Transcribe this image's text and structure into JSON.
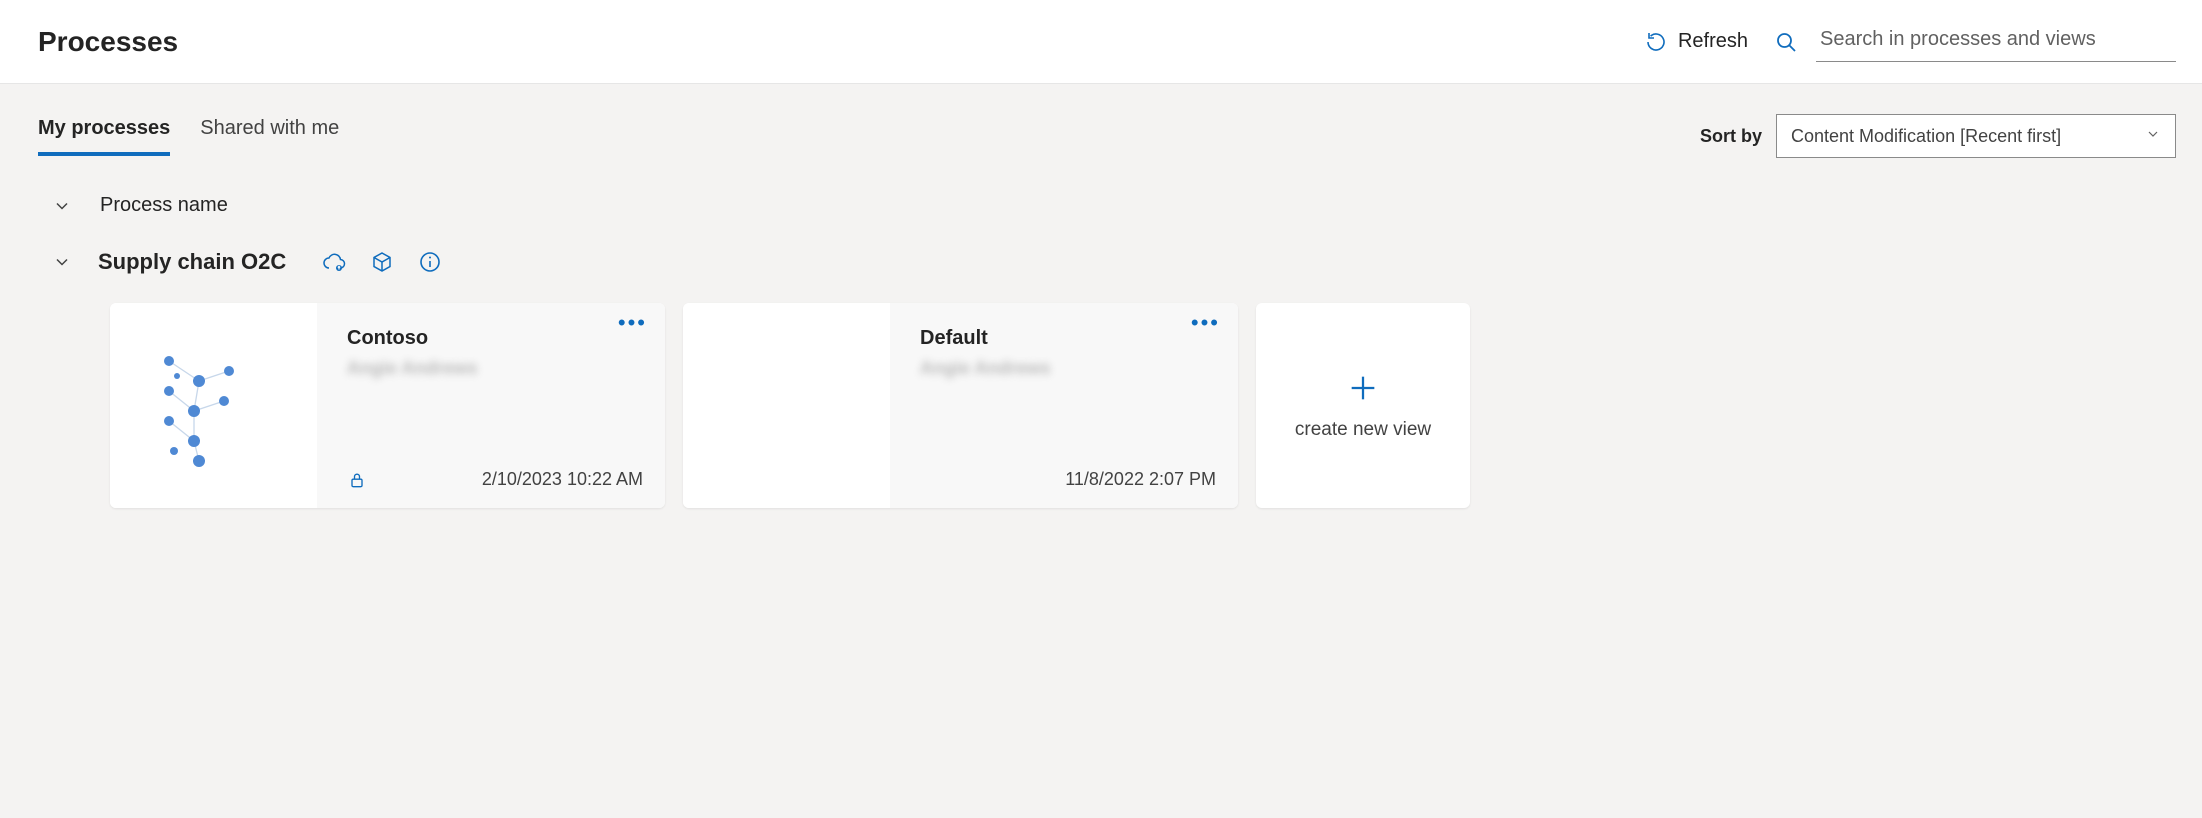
{
  "header": {
    "title": "Processes",
    "refresh_label": "Refresh",
    "search_placeholder": "Search in processes and views"
  },
  "tabs": {
    "my_processes": "My processes",
    "shared_with_me": "Shared with me",
    "active": "my_processes"
  },
  "sort": {
    "label": "Sort by",
    "selected": "Content Modification [Recent first]"
  },
  "section": {
    "process_name_label": "Process name"
  },
  "process": {
    "name": "Supply chain O2C",
    "views": [
      {
        "title": "Contoso",
        "owner": "Angie Andrews",
        "date": "2/10/2023 10:22 AM",
        "locked": true,
        "has_thumb": true
      },
      {
        "title": "Default",
        "owner": "Angie Andrews",
        "date": "11/8/2022 2:07 PM",
        "locked": false,
        "has_thumb": false
      }
    ]
  },
  "new_view": {
    "label": "create new view"
  },
  "icons": {
    "refresh": "refresh-icon",
    "search": "search-icon",
    "cloud_up": "cloud-upload-icon",
    "cube": "cube-icon",
    "info": "info-icon",
    "lock": "lock-icon",
    "plus": "plus-icon",
    "chevron_down": "chevron-down-icon",
    "more": "more-icon"
  }
}
